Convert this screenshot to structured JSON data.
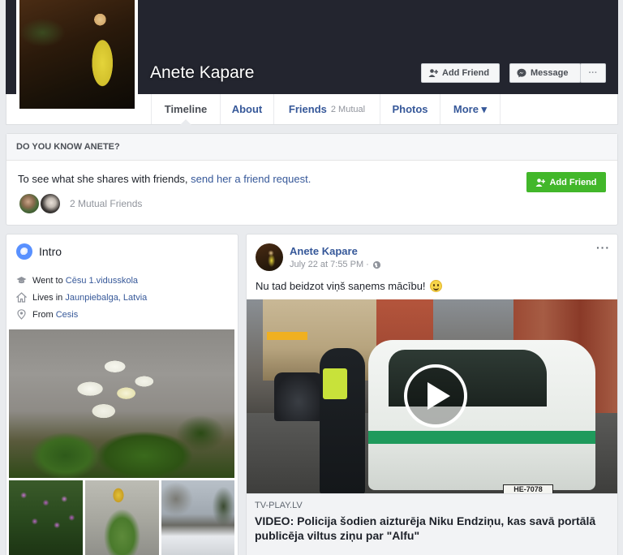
{
  "profile": {
    "name": "Anete Kapare",
    "add_friend_label": "Add Friend",
    "message_label": "Message",
    "more_dots": "···"
  },
  "tabs": {
    "timeline": "Timeline",
    "about": "About",
    "friends": "Friends",
    "friends_sub": "2 Mutual",
    "photos": "Photos",
    "more": "More ▾"
  },
  "know_card": {
    "header": "DO YOU KNOW ANETE?",
    "text_prefix": "To see what she shares with friends, ",
    "link_text": "send her a friend request.",
    "button_label": "Add Friend",
    "mutual_text": "2 Mutual Friends"
  },
  "intro": {
    "title": "Intro",
    "education_prefix": "Went to ",
    "education_place": "Cēsu 1.vidusskola",
    "lives_prefix": "Lives in ",
    "lives_place": "Jaunpiebalga, Latvia",
    "from_prefix": "From ",
    "from_place": "Cesis"
  },
  "post": {
    "author": "Anete Kapare",
    "timestamp": "July 22 at 7:55 PM ·",
    "options": "···",
    "text": "Nu tad beidzot viņš saņems mācību!",
    "link_source": "TV-PLAY.LV",
    "link_title": "VIDEO: Policija šodien aizturēja Niku Endziņu, kas savā portālā publicēja viltus ziņu par \"Alfu\"",
    "plate_text": "HE-7078"
  },
  "colors": {
    "link_blue": "#365899",
    "green_button": "#42b72a",
    "cover_bg": "#23252f",
    "page_bg": "#e9ebee"
  },
  "icons": [
    "add-friend-icon",
    "messenger-icon",
    "globe-icon",
    "graduation-cap-icon",
    "home-icon",
    "location-pin-icon",
    "public-globe-icon",
    "play-icon",
    "smile-emoji-icon"
  ]
}
